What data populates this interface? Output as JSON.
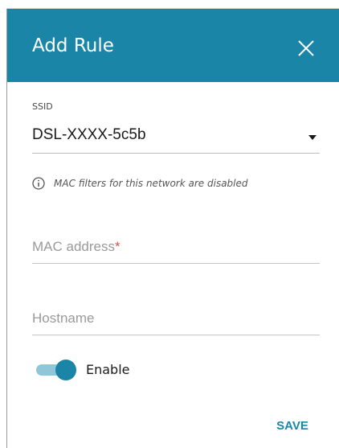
{
  "dialog": {
    "title": "Add Rule",
    "close_icon": "close-icon",
    "header_color": "#1b85a8"
  },
  "ssid": {
    "label": "SSID",
    "value": "DSL-XXXX-5c5b",
    "dropdown_icon": "chevron-down-icon"
  },
  "info": {
    "icon": "info-icon",
    "text": "MAC filters for this network are disabled"
  },
  "mac": {
    "placeholder": "MAC address",
    "required_mark": "*"
  },
  "hostname": {
    "placeholder": "Hostname"
  },
  "enable": {
    "label": "Enable",
    "checked": true
  },
  "actions": {
    "save_label": "SAVE"
  },
  "colors": {
    "accent": "#1b85a8",
    "required": "#d9534f"
  }
}
